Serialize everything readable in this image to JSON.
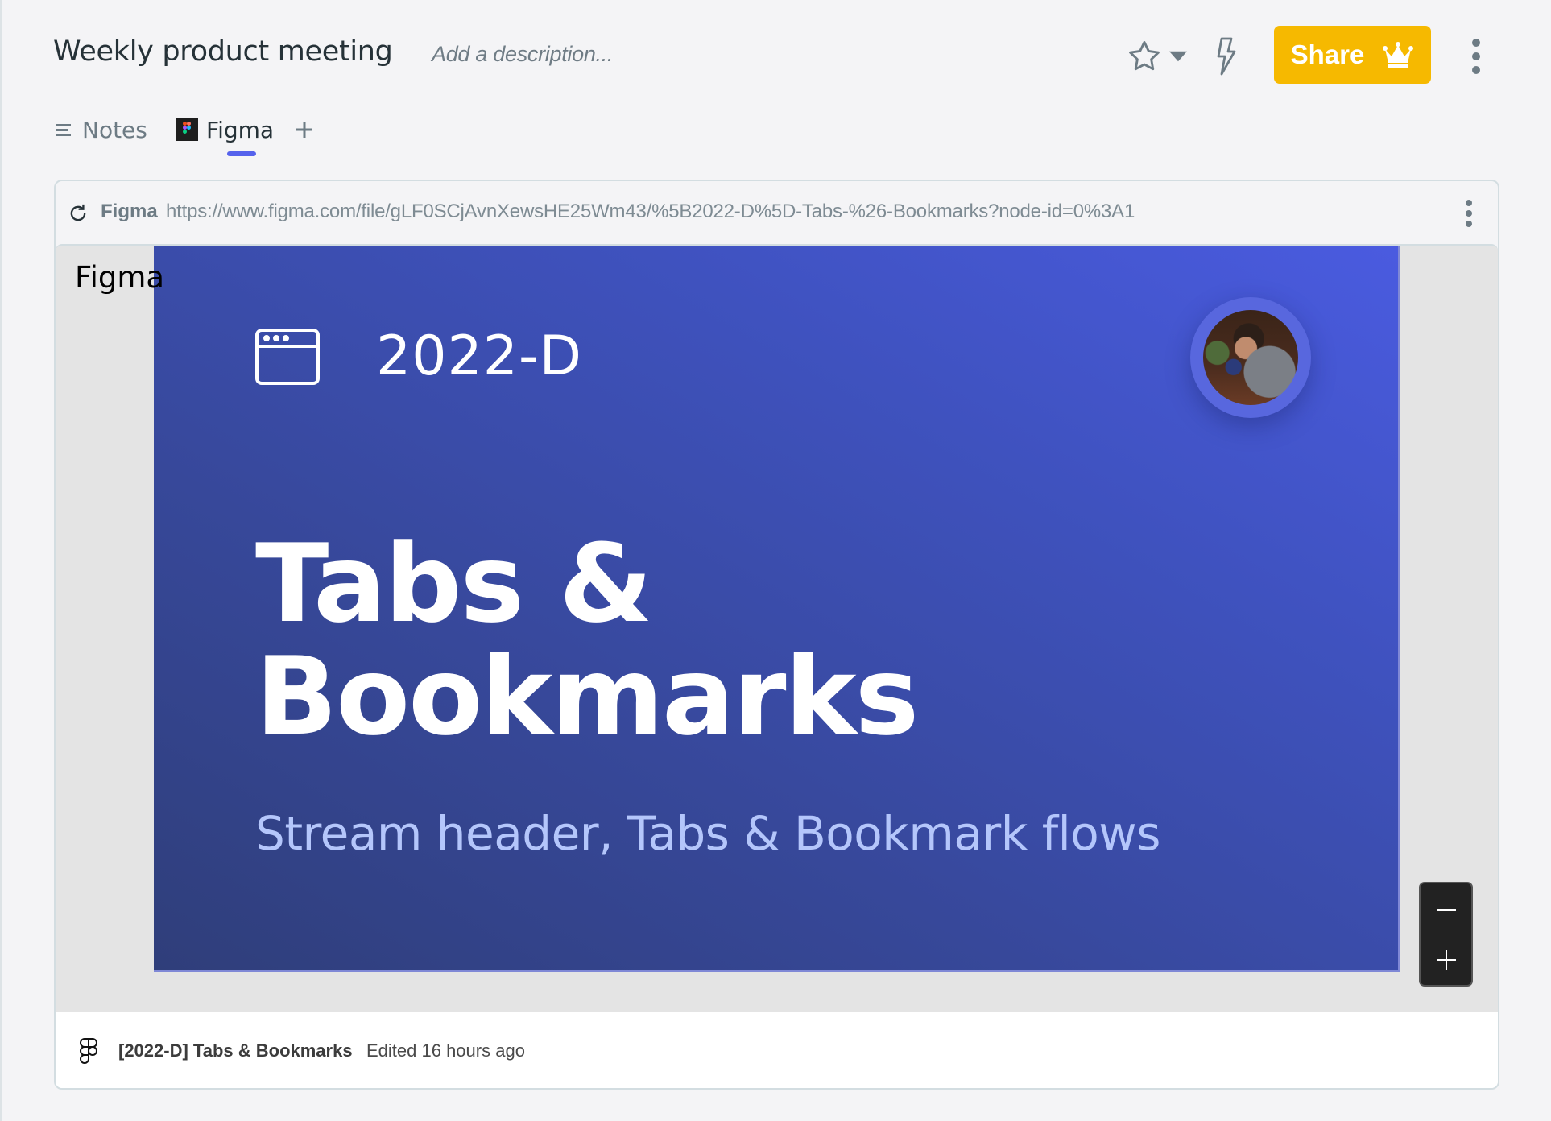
{
  "header": {
    "title": "Weekly product meeting",
    "description_placeholder": "Add a description...",
    "share_label": "Share",
    "icons": {
      "favorite": "star-outline-icon",
      "favorite_menu": "caret-down-icon",
      "automation": "lightning-icon",
      "share_badge": "crown-icon",
      "more": "kebab-vertical-icon"
    },
    "colors": {
      "share_bg": "#f6b900",
      "tab_active_indicator": "#5562ec"
    }
  },
  "tabs": [
    {
      "label": "Notes",
      "icon": "notes-lines-icon",
      "active": false
    },
    {
      "label": "Figma",
      "icon": "figma-logo-icon",
      "active": true
    }
  ],
  "add_tab_icon": "plus-icon",
  "embed": {
    "source": "Figma",
    "url": "https://www.figma.com/file/gLF0SCjAvnXewsHE25Wm43/%5B2022-D%5D-Tabs-%26-Bookmarks?node-id=0%3A1",
    "frame_label": "Figma",
    "slide": {
      "code": "2022-D",
      "title_line1": "Tabs &",
      "title_line2": "Bookmarks",
      "subtitle": "Stream header, Tabs & Bookmark flows",
      "icon": "browser-window-icon",
      "avatar": "user-avatar-photo"
    },
    "zoom_out_icon": "minus-icon",
    "zoom_in_icon": "plus-icon",
    "footer": {
      "file_name": "[2022-D] Tabs & Bookmarks",
      "edited": "Edited 16 hours ago"
    }
  }
}
